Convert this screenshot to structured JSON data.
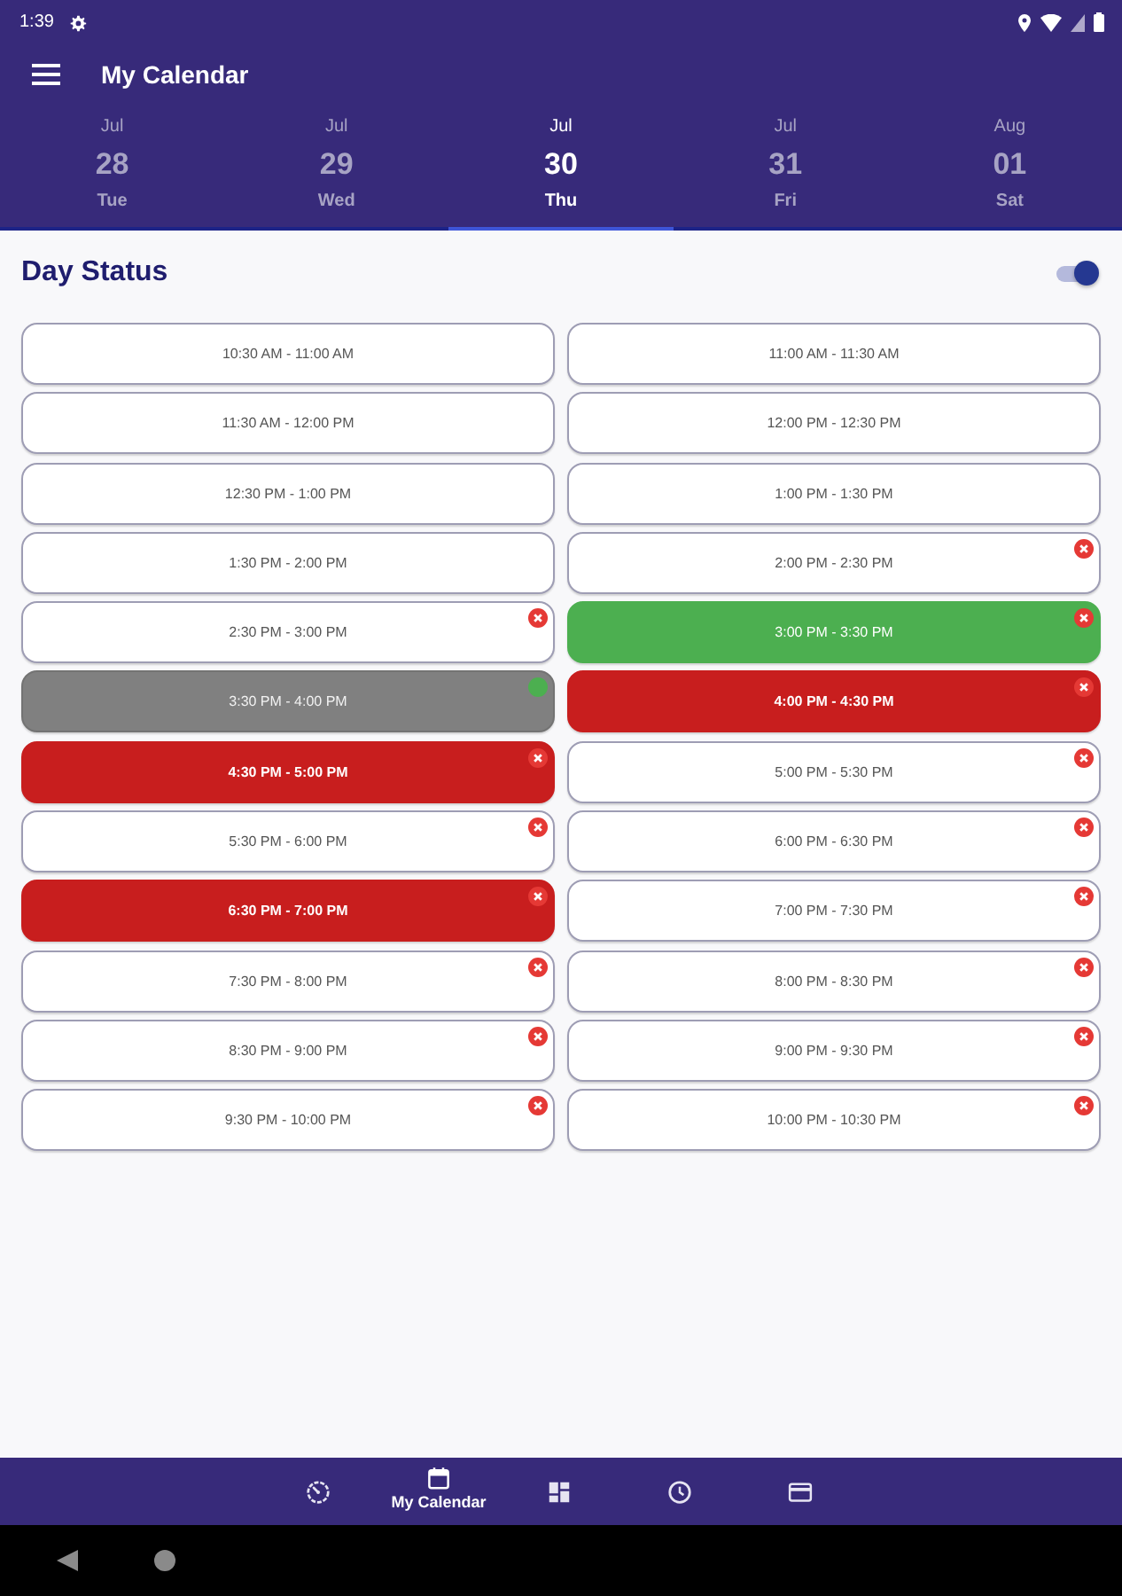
{
  "status_bar": {
    "time": "1:39"
  },
  "app_bar": {
    "title": "My Calendar"
  },
  "date_tabs": [
    {
      "month": "Jul",
      "day": "28",
      "weekday": "Tue",
      "selected": false
    },
    {
      "month": "Jul",
      "day": "29",
      "weekday": "Wed",
      "selected": false
    },
    {
      "month": "Jul",
      "day": "30",
      "weekday": "Thu",
      "selected": true
    },
    {
      "month": "Jul",
      "day": "31",
      "weekday": "Fri",
      "selected": false
    },
    {
      "month": "Aug",
      "day": "01",
      "weekday": "Sat",
      "selected": false
    }
  ],
  "day_status": {
    "title": "Day Status",
    "toggle": {
      "on": true
    }
  },
  "slots": [
    {
      "label": "10:30 AM - 11:00 AM",
      "kind": "free",
      "removable": false,
      "confirmed": false
    },
    {
      "label": "11:00 AM - 11:30 AM",
      "kind": "free",
      "removable": false,
      "confirmed": false
    },
    {
      "label": "11:30 AM - 12:00 PM",
      "kind": "free",
      "removable": false,
      "confirmed": false
    },
    {
      "label": "12:00 PM - 12:30 PM",
      "kind": "free",
      "removable": false,
      "confirmed": false
    },
    {
      "label": "12:30 PM - 1:00 PM",
      "kind": "free",
      "removable": false,
      "confirmed": false
    },
    {
      "label": "1:00 PM - 1:30 PM",
      "kind": "free",
      "removable": false,
      "confirmed": false
    },
    {
      "label": "1:30 PM - 2:00 PM",
      "kind": "free",
      "removable": false,
      "confirmed": false
    },
    {
      "label": "2:00 PM - 2:30 PM",
      "kind": "free",
      "removable": true,
      "confirmed": false
    },
    {
      "label": "2:30 PM - 3:00 PM",
      "kind": "free",
      "removable": true,
      "confirmed": false
    },
    {
      "label": "3:00 PM - 3:30 PM",
      "kind": "booked",
      "removable": true,
      "confirmed": false
    },
    {
      "label": "3:30 PM - 4:00 PM",
      "kind": "unavailable",
      "removable": false,
      "confirmed": true
    },
    {
      "label": "4:00 PM - 4:30 PM",
      "kind": "busy",
      "removable": true,
      "confirmed": false
    },
    {
      "label": "4:30 PM - 5:00 PM",
      "kind": "busy",
      "removable": true,
      "confirmed": false
    },
    {
      "label": "5:00 PM - 5:30 PM",
      "kind": "free",
      "removable": true,
      "confirmed": false
    },
    {
      "label": "5:30 PM - 6:00 PM",
      "kind": "free",
      "removable": true,
      "confirmed": false
    },
    {
      "label": "6:00 PM - 6:30 PM",
      "kind": "free",
      "removable": true,
      "confirmed": false
    },
    {
      "label": "6:30 PM - 7:00 PM",
      "kind": "busy",
      "removable": true,
      "confirmed": false
    },
    {
      "label": "7:00 PM - 7:30 PM",
      "kind": "free",
      "removable": true,
      "confirmed": false
    },
    {
      "label": "7:30 PM - 8:00 PM",
      "kind": "free",
      "removable": true,
      "confirmed": false
    },
    {
      "label": "8:00 PM - 8:30 PM",
      "kind": "free",
      "removable": true,
      "confirmed": false
    },
    {
      "label": "8:30 PM - 9:00 PM",
      "kind": "free",
      "removable": true,
      "confirmed": false
    },
    {
      "label": "9:00 PM - 9:30 PM",
      "kind": "free",
      "removable": true,
      "confirmed": false
    },
    {
      "label": "9:30 PM - 10:00 PM",
      "kind": "free",
      "removable": true,
      "confirmed": false
    },
    {
      "label": "10:00 PM - 10:30 PM",
      "kind": "free",
      "removable": true,
      "confirmed": false
    }
  ],
  "bottom_nav": [
    {
      "kind": "timer",
      "selected": false
    },
    {
      "kind": "calendar",
      "label": "My Calendar",
      "selected": true
    },
    {
      "kind": "dashboard",
      "selected": false
    },
    {
      "kind": "clock",
      "selected": false
    },
    {
      "kind": "card",
      "selected": false
    }
  ]
}
